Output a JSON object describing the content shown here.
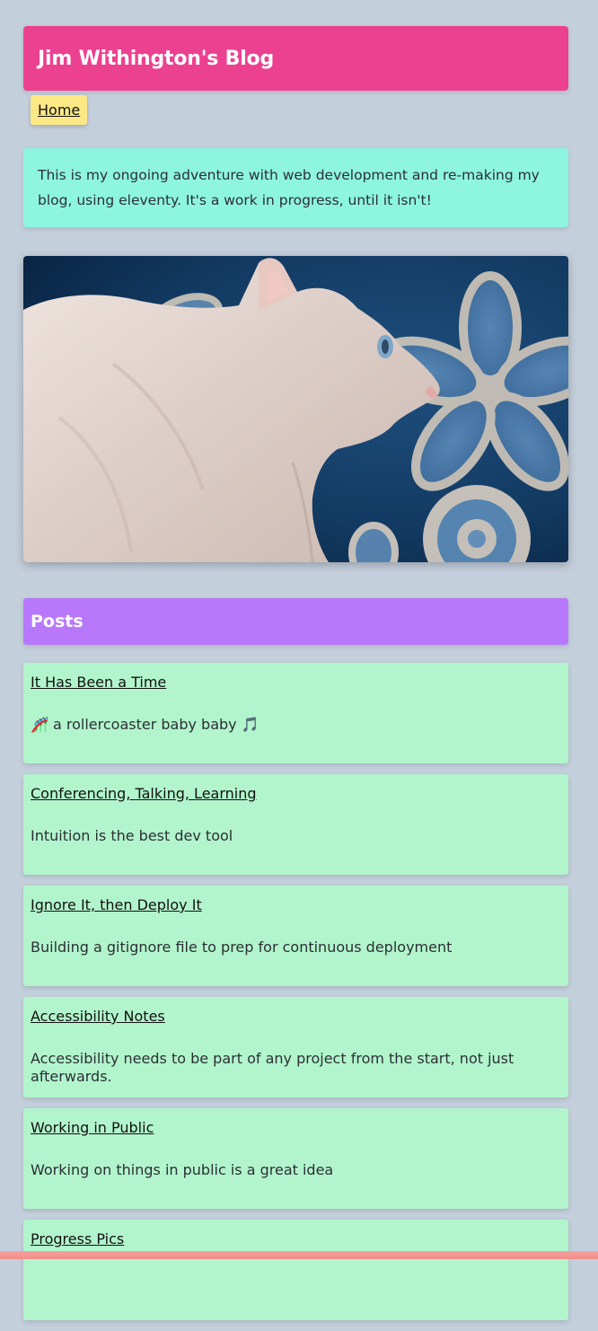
{
  "site": {
    "title": "Jim Withington's Blog"
  },
  "nav": {
    "home_label": "Home"
  },
  "intro": {
    "text": "This is my ongoing adventure with web development and re-making my blog, using eleventy. It's a work in progress, until it isn't!"
  },
  "hero": {
    "image_subject": "white devon rex cat in profile"
  },
  "posts": {
    "heading": "Posts",
    "items": [
      {
        "title": "It Has Been a Time",
        "excerpt": "🎢 a rollercoaster baby baby 🎵"
      },
      {
        "title": "Conferencing, Talking, Learning",
        "excerpt": "Intuition is the best dev tool"
      },
      {
        "title": "Ignore It, then Deploy It",
        "excerpt": "Building a gitignore file to prep for continuous deployment"
      },
      {
        "title": "Accessibility Notes",
        "excerpt": "Accessibility needs to be part of any project from the start, not just afterwards."
      },
      {
        "title": "Working in Public",
        "excerpt": "Working on things in public is a great idea"
      },
      {
        "title": "Progress Pics",
        "excerpt": ""
      }
    ]
  },
  "colors": {
    "background": "#c4cfdc",
    "header": "#ec4190",
    "nav_link": "#fde886",
    "intro": "#8ef5df",
    "posts_header": "#b878fb",
    "post_card": "#b2f5cc"
  }
}
